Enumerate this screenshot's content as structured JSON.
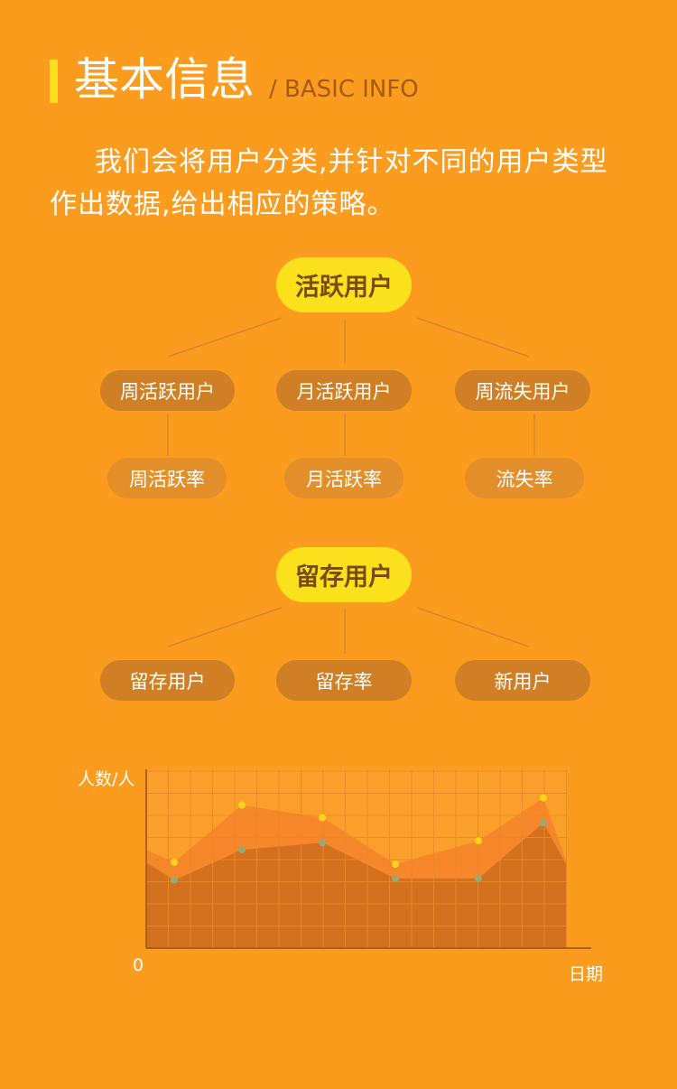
{
  "header": {
    "title": "基本信息",
    "subtitle": "/ BASIC INFO"
  },
  "description": "我们会将用户分类,并针对不同的用户类型作出数据,给出相应的策略。",
  "diagram_active": {
    "root": "活跃用户",
    "level1": [
      "周活跃用户",
      "月活跃用户",
      "周流失用户"
    ],
    "level2": [
      "周活跃率",
      "月活跃率",
      "流失率"
    ]
  },
  "diagram_retention": {
    "root": "留存用户",
    "level1": [
      "留存用户",
      "留存率",
      "新用户"
    ]
  },
  "chart_data": {
    "type": "area",
    "xlabel": "日期",
    "ylabel": "人数/人",
    "origin_label": "0",
    "grid": true,
    "x": [
      1,
      2,
      3,
      4,
      5,
      6
    ],
    "series": [
      {
        "values": [
          48,
          80,
          73,
          47,
          60,
          84
        ],
        "start": 55,
        "end": 48,
        "color": "#f4822a",
        "dot_color": "#fbd21c"
      },
      {
        "values": [
          38,
          55,
          59,
          39,
          39,
          70
        ],
        "start": 48,
        "end": 46,
        "color": "#d06f1e",
        "dot_color": "#9aa878"
      }
    ],
    "ylim": [
      0,
      100
    ]
  }
}
